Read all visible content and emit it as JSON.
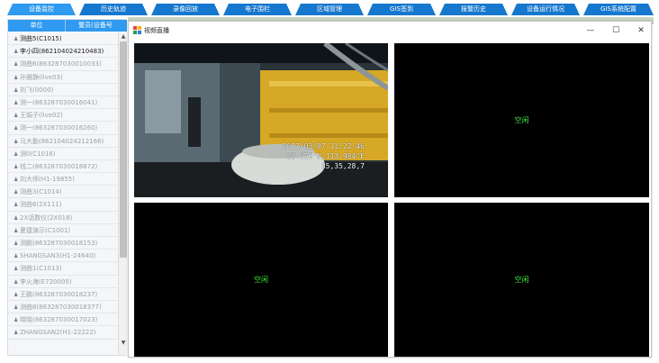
{
  "nav": {
    "tabs": [
      {
        "label": "设备监控",
        "active": true
      },
      {
        "label": "历史轨迹",
        "active": false
      },
      {
        "label": "录像回放",
        "active": false
      },
      {
        "label": "电子围栏",
        "active": false
      },
      {
        "label": "区域管理",
        "active": false
      },
      {
        "label": "GIS签到",
        "active": false
      },
      {
        "label": "报警历史",
        "active": false
      },
      {
        "label": "设备运行情况",
        "active": false
      },
      {
        "label": "GIS系统配置",
        "active": false
      }
    ]
  },
  "device_list": {
    "columns": [
      "单位",
      "警员(设备号"
    ],
    "items": [
      {
        "label": "测曲5(C1015)",
        "online": true
      },
      {
        "label": "李小四(862104024210483)",
        "online": true
      },
      {
        "label": "测曲6(863287030010033)",
        "online": false
      },
      {
        "label": "孙雅静(live03)",
        "online": false
      },
      {
        "label": "刘飞(0000)",
        "online": false
      },
      {
        "label": "测一(863287030016041)",
        "online": false
      },
      {
        "label": "王娟子(live02)",
        "online": false
      },
      {
        "label": "测一(863287030016260)",
        "online": false
      },
      {
        "label": "马大勤(862104024212166)",
        "online": false
      },
      {
        "label": "测0(C1016)",
        "online": false
      },
      {
        "label": "钱二(863287030018872)",
        "online": false
      },
      {
        "label": "刘大师(H1-19855)",
        "online": false
      },
      {
        "label": "测曲3(C1014)",
        "online": false
      },
      {
        "label": "测曲6(2X111)",
        "online": false
      },
      {
        "label": "2X话数仪(2X018)",
        "online": false
      },
      {
        "label": "夏捷演示(C1001)",
        "online": false
      },
      {
        "label": "测鹏(863287030018153)",
        "online": false
      },
      {
        "label": "SHANGSAN3(H1-24640)",
        "online": false
      },
      {
        "label": "测曲1(C1013)",
        "online": false
      },
      {
        "label": "李火海(E720005)",
        "online": false
      },
      {
        "label": "王鹏(863287030018237)",
        "online": false
      },
      {
        "label": "测曲8(863287030018377)",
        "online": false
      },
      {
        "label": "晓晓(863287030017023)",
        "online": false
      },
      {
        "label": "ZHANGSAN2(H1-22222)",
        "online": false
      }
    ]
  },
  "video_window": {
    "title": "视频直播",
    "controls": {
      "minimize": "—",
      "maximize": "☐",
      "close": "✕"
    },
    "channels": [
      {
        "state": "live",
        "osd": [
          "2017/03/07 11:22:46",
          "22.626°N,113.984°E",
          "35,35,28,7"
        ]
      },
      {
        "state": "idle",
        "label": "空闲"
      },
      {
        "state": "idle",
        "label": "空闲"
      },
      {
        "state": "idle",
        "label": "空闲"
      }
    ]
  },
  "colors": {
    "nav_tab": "#1677ce",
    "nav_tab_active": "#2f9aef",
    "idle_text": "#39e639"
  }
}
